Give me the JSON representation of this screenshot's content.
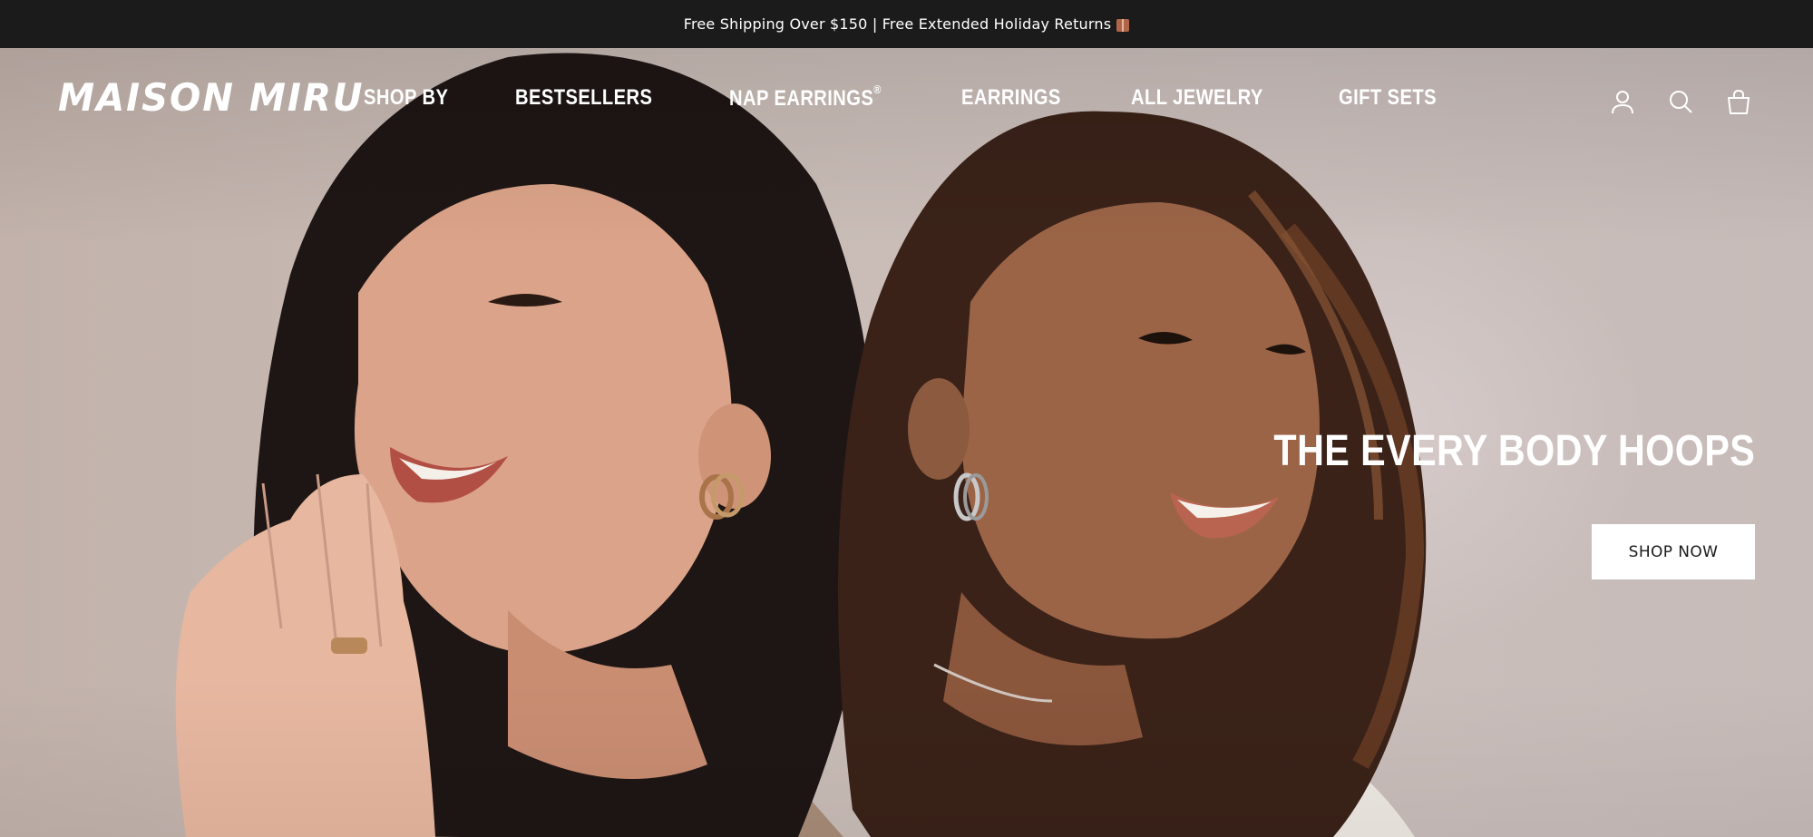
{
  "announcement": {
    "text": "Free Shipping Over $150 | Free Extended Holiday Returns",
    "icon": "gift-icon"
  },
  "header": {
    "logo": "MAISON MIRU",
    "nav": [
      {
        "label": "SHOP BY"
      },
      {
        "label": "BESTSELLERS"
      },
      {
        "label": "NAP EARRINGS",
        "suffix": "®"
      },
      {
        "label": "EARRINGS"
      },
      {
        "label": "ALL JEWELRY"
      },
      {
        "label": "GIFT SETS"
      }
    ],
    "icons": [
      "account-icon",
      "search-icon",
      "cart-bag-icon"
    ]
  },
  "hero": {
    "title": "THE EVERY BODY HOOPS",
    "cta": "SHOP NOW"
  },
  "colors": {
    "announcement_bg": "#1b1b1b",
    "text_light": "#ffffff",
    "cta_bg": "#ffffff",
    "cta_text": "#1b1b1b"
  }
}
